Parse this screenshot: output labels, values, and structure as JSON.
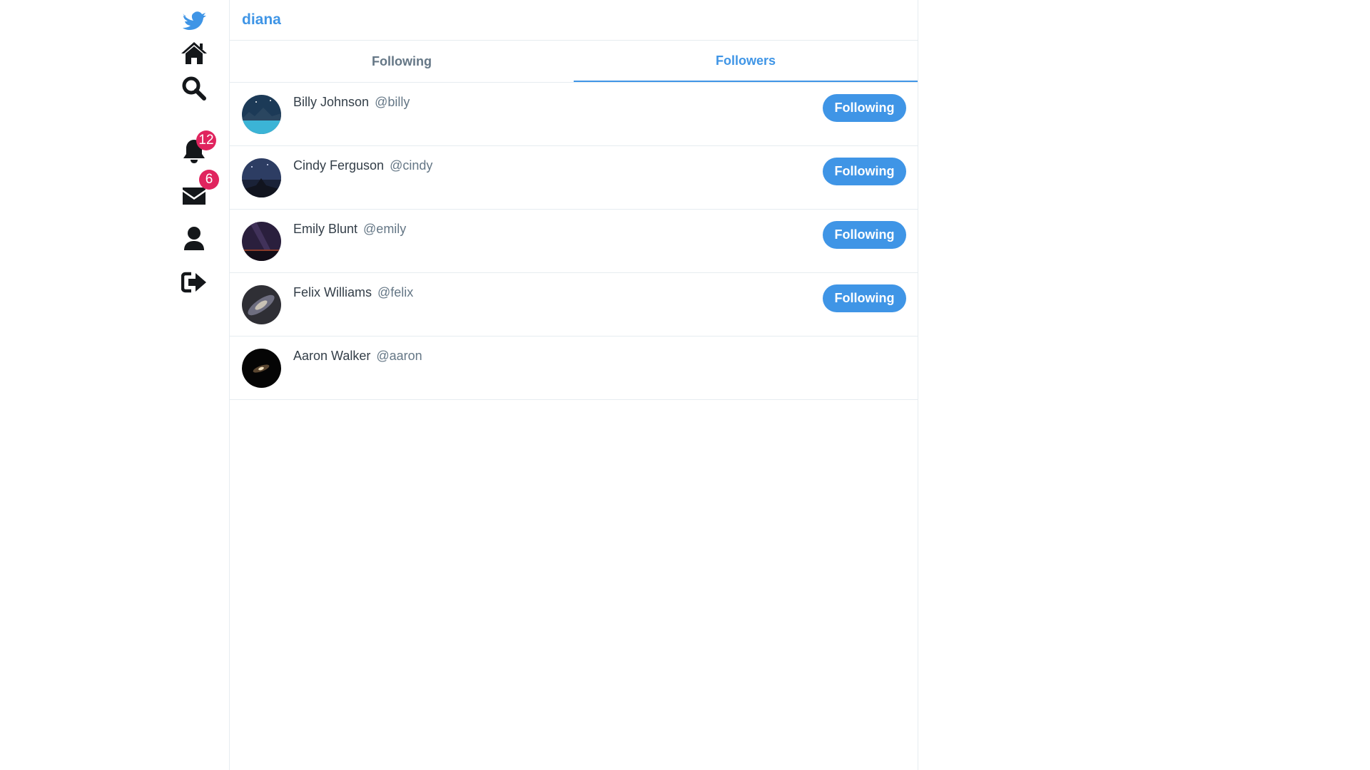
{
  "nav": {
    "logo_icon": "bird-logo-icon",
    "items": [
      {
        "icon": "home-icon"
      },
      {
        "icon": "search-icon"
      },
      {
        "icon": "bell-icon",
        "badge": "12"
      },
      {
        "icon": "envelope-icon",
        "badge": "6"
      },
      {
        "icon": "user-icon"
      },
      {
        "icon": "sign-out-icon"
      }
    ]
  },
  "header": {
    "title": "diana"
  },
  "tabs": [
    {
      "label": "Following",
      "active": false
    },
    {
      "label": "Followers",
      "active": true
    }
  ],
  "users": [
    {
      "name": "Billy Johnson",
      "handle": "@billy",
      "button": "Following"
    },
    {
      "name": "Cindy Ferguson",
      "handle": "@cindy",
      "button": "Following"
    },
    {
      "name": "Emily Blunt",
      "handle": "@emily",
      "button": "Following"
    },
    {
      "name": "Felix Williams",
      "handle": "@felix",
      "button": "Following"
    },
    {
      "name": "Aaron Walker",
      "handle": "@aaron",
      "button": ""
    }
  ],
  "colors": {
    "accent": "#3f95e6",
    "badge": "#e0245e",
    "icon": "#14171a",
    "border": "#e6ecf0"
  }
}
